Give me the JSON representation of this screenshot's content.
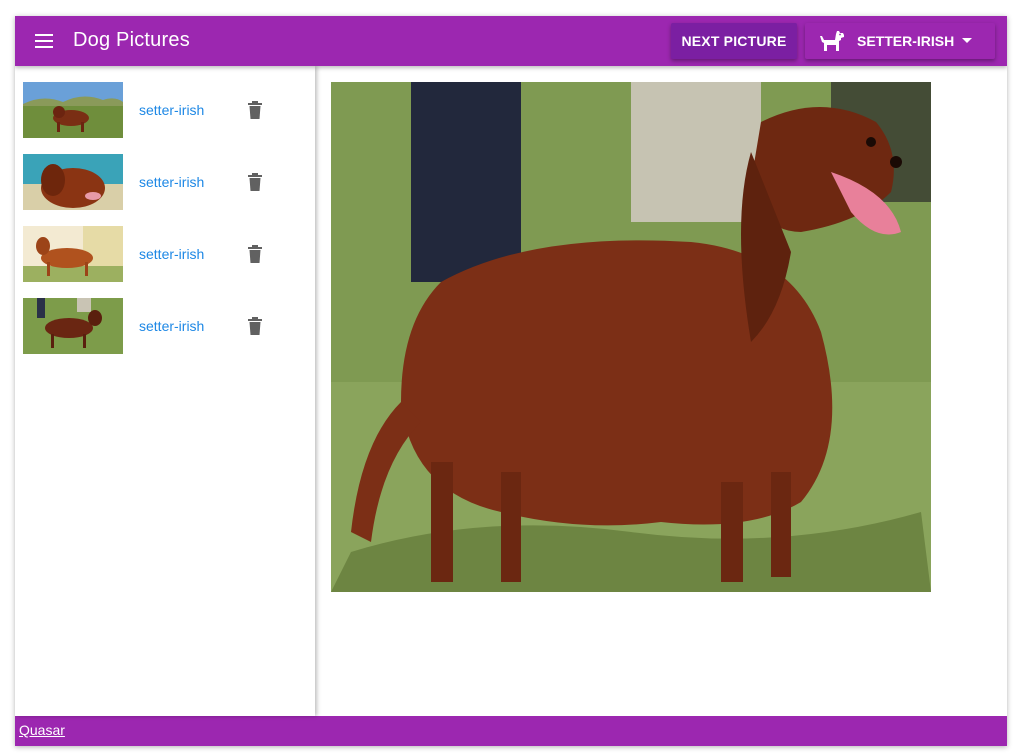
{
  "header": {
    "title": "Dog Pictures",
    "menu_icon": "menu-icon",
    "next_button_label": "Next Picture",
    "breed_select": {
      "icon": "dog-icon",
      "selected": "setter-irish",
      "caret_icon": "arrow-drop-down-icon"
    }
  },
  "sidebar": {
    "items": [
      {
        "label": "setter-irish",
        "icon": "trash-icon"
      },
      {
        "label": "setter-irish",
        "icon": "trash-icon"
      },
      {
        "label": "setter-irish",
        "icon": "trash-icon"
      },
      {
        "label": "setter-irish",
        "icon": "trash-icon"
      }
    ]
  },
  "footer": {
    "link_label": "Quasar"
  },
  "colors": {
    "primary": "#9c27b0",
    "primary_dark": "#7b1fa2",
    "link": "#1e88e5",
    "icon_gray": "#616161"
  }
}
